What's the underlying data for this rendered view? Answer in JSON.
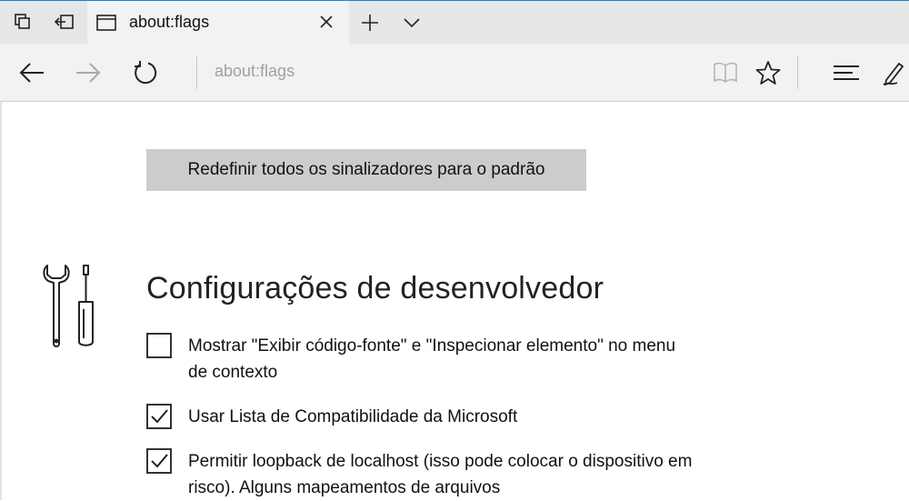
{
  "tab": {
    "title": "about:flags"
  },
  "address_bar": {
    "url": "about:flags"
  },
  "icons": {
    "tab_preview": "tabs-preview-icon",
    "set_aside": "set-aside-tabs-icon",
    "favicon": "page-icon",
    "close": "close-icon",
    "new_tab": "plus-icon",
    "tab_menu": "chevron-down-icon",
    "back": "back-arrow-icon",
    "forward": "forward-arrow-icon",
    "refresh": "refresh-icon",
    "reading_view": "book-icon",
    "favorites": "star-icon",
    "hub": "hub-icon",
    "notes": "pen-icon",
    "tools": "wrench-screwdriver-icon"
  },
  "page": {
    "reset_button": "Redefinir todos os sinalizadores para o padrão",
    "section_title": "Configurações de desenvolvedor",
    "options": [
      {
        "label": "Mostrar \"Exibir código-fonte\" e \"Inspecionar elemento\" no menu de contexto",
        "checked": false
      },
      {
        "label": "Usar Lista de Compatibilidade da Microsoft",
        "checked": true
      },
      {
        "label": "Permitir loopback de localhost (isso pode colocar o dispositivo em risco). Alguns mapeamentos de arquivos",
        "checked": true
      }
    ]
  },
  "colors": {
    "accent": "#1883d7",
    "tab_bar": "#e6e6e6",
    "toolbar": "#f2f2f2",
    "button": "#cccccc"
  }
}
